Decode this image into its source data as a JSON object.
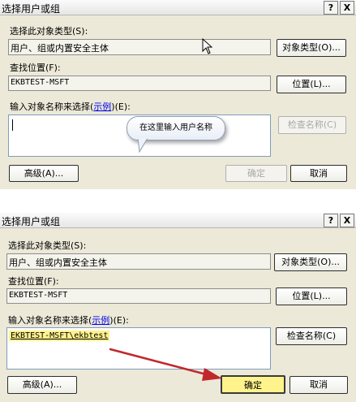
{
  "dialog_before": {
    "title": "选择用户或组",
    "help_button": "?",
    "close_button": "X",
    "object_type_label": "选择此对象类型(S):",
    "object_type_value": "用户、组或内置安全主体",
    "object_types_button": "对象类型(O)...",
    "location_label": "查找位置(F):",
    "location_value": "EKBTEST-MSFT",
    "locations_button": "位置(L)...",
    "names_label_prefix": "输入对象名称来选择(",
    "names_label_link": "示例",
    "names_label_suffix": ")(E):",
    "names_value": "",
    "check_names_button": "检查名称(C)",
    "advanced_button": "高级(A)...",
    "ok_button": "确定",
    "cancel_button": "取消",
    "tooltip_text": "在这里输入用户名称"
  },
  "dialog_after": {
    "title": "选择用户或组",
    "help_button": "?",
    "close_button": "X",
    "object_type_label": "选择此对象类型(S):",
    "object_type_value": "用户、组或内置安全主体",
    "object_types_button": "对象类型(O)...",
    "location_label": "查找位置(F):",
    "location_value": "EKBTEST-MSFT",
    "locations_button": "位置(L)...",
    "names_label_prefix": "输入对象名称来选择(",
    "names_label_link": "示例",
    "names_label_suffix": ")(E):",
    "names_value": "EKBTEST-MSFT\\ekbtest",
    "check_names_button": "检查名称(C)",
    "advanced_button": "高级(A)...",
    "ok_button": "确定",
    "cancel_button": "取消"
  },
  "colors": {
    "dialog_bg": "#ece9d8",
    "highlight": "#fff38c",
    "arrow": "#c0282d",
    "link": "#0000ee"
  }
}
